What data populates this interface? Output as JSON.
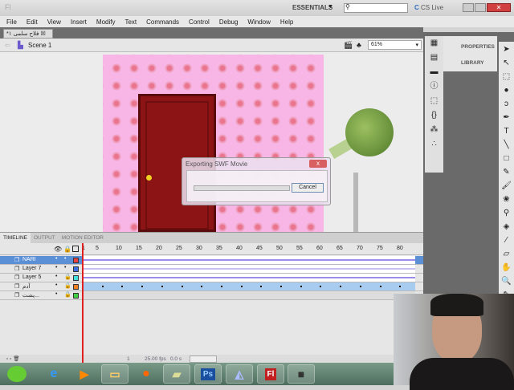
{
  "titlebar": {
    "app_icon": "Fl",
    "workspace": "ESSENTIALS",
    "search_placeholder": "",
    "cs_live": "CS Live"
  },
  "menu": [
    "File",
    "Edit",
    "View",
    "Insert",
    "Modify",
    "Text",
    "Commands",
    "Control",
    "Debug",
    "Window",
    "Help"
  ],
  "document_tab": "*فلاح سلمی ۱",
  "scene": {
    "label": "Scene 1",
    "zoom": "61%"
  },
  "dialog": {
    "title": "Exporting SWF Movie",
    "cancel": "Cancel",
    "close": "x",
    "progress": 0
  },
  "timeline": {
    "tabs": [
      "TIMELINE",
      "OUTPUT",
      "MOTION EDITOR"
    ],
    "frame_numbers": [
      "1",
      "5",
      "10",
      "15",
      "20",
      "25",
      "30",
      "35",
      "40",
      "45",
      "50",
      "55",
      "60",
      "65",
      "70",
      "75",
      "80"
    ],
    "layers": [
      {
        "name": "NARI",
        "color": "#e84040",
        "selected": true
      },
      {
        "name": "Layer 7",
        "color": "#3a6ee8"
      },
      {
        "name": "Layer 5",
        "color": "#40e0e0"
      },
      {
        "name": "آدم",
        "color": "#f08020"
      },
      {
        "name": "پشت...",
        "color": "#40d040"
      }
    ],
    "status": {
      "frame": "1",
      "fps": "25.00 fps",
      "time": "0.0 s"
    }
  },
  "panels": {
    "properties": "PROPERTIES",
    "library": "LIBRARY"
  },
  "taskbar": [
    "angry-birds",
    "internet-explorer",
    "media-player",
    "explorer",
    "firefox",
    "sticky-notes",
    "photoshop",
    "app",
    "flash",
    "camera"
  ],
  "taskbar_labels": {
    "photoshop": "Ps",
    "flash": "Fl"
  }
}
